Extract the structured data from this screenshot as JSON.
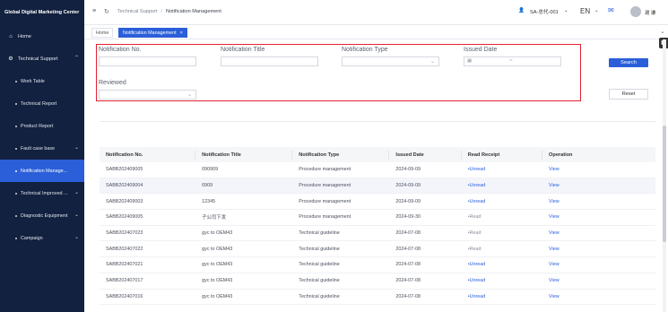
{
  "app_title": "Global Digital Marketing Center",
  "sidebar": {
    "items": [
      {
        "label": "Home",
        "icon": "home-icon"
      },
      {
        "label": "Technical Support",
        "icon": "gear-icon"
      }
    ],
    "sub_items": [
      {
        "label": "Work Table"
      },
      {
        "label": "Technical Report"
      },
      {
        "label": "Product Report"
      },
      {
        "label": "Fault case base"
      },
      {
        "label": "Notification Manage..."
      },
      {
        "label": "Technical Improved ..."
      },
      {
        "label": "Diagnostic Equipment"
      },
      {
        "label": "Campaign"
      }
    ]
  },
  "header": {
    "breadcrumb": [
      "Technical Support",
      "Notification Management"
    ],
    "user_code": "SA-总代-001",
    "language": "EN",
    "user_name": "谢 谦"
  },
  "tabs": [
    {
      "label": "Home"
    },
    {
      "label": "Notification Management"
    }
  ],
  "filters": {
    "notification_no_label": "Notification No.",
    "notification_title_label": "Notification Title",
    "notification_type_label": "Notification Type",
    "issued_date_label": "Issued Date",
    "reviewed_label": "Reviewed",
    "date_separator": "~",
    "search_label": "Search",
    "reset_label": "Reset"
  },
  "table": {
    "columns": [
      "Notification No.",
      "Notification Title",
      "Notification Type",
      "Issued Date",
      "Read Receipt",
      "Operation"
    ],
    "rows": [
      {
        "no": "SABB202409005",
        "title": "090909",
        "type": "Procedure management",
        "date": "2024-09-09",
        "receipt": "Unread",
        "op": "View"
      },
      {
        "no": "SABB202409004",
        "title": "0909",
        "type": "Procedure management",
        "date": "2024-09-09",
        "receipt": "Unread",
        "op": "View"
      },
      {
        "no": "SABB202409003",
        "title": "12345",
        "type": "Procedure management",
        "date": "2024-09-09",
        "receipt": "Unread",
        "op": "View"
      },
      {
        "no": "SABB202409005",
        "title": "子公司下发",
        "type": "Procedure management",
        "date": "2024-09-30",
        "receipt": "Read",
        "op": "View"
      },
      {
        "no": "SABB202407023",
        "title": "gyc to OEM43",
        "type": "Technical guideline",
        "date": "2024-07-08",
        "receipt": "Read",
        "op": "View"
      },
      {
        "no": "SABB202407022",
        "title": "gyc to OEM43",
        "type": "Technical guideline",
        "date": "2024-07-08",
        "receipt": "Read",
        "op": "View"
      },
      {
        "no": "SABB202407021",
        "title": "gyc to OEM43",
        "type": "Technical guideline",
        "date": "2024-07-08",
        "receipt": "Unread",
        "op": "View"
      },
      {
        "no": "SABB202407017",
        "title": "gyc to OEM43",
        "type": "Technical guideline",
        "date": "2024-07-08",
        "receipt": "Unread",
        "op": "View"
      },
      {
        "no": "SABB202407016",
        "title": "gyc to OEM43",
        "type": "Technical guideline",
        "date": "2024-07-08",
        "receipt": "Unread",
        "op": "View"
      }
    ]
  },
  "colors": {
    "sidebar_bg": "#12213f",
    "accent": "#2b5fd9",
    "highlight_border": "#e0222f"
  }
}
